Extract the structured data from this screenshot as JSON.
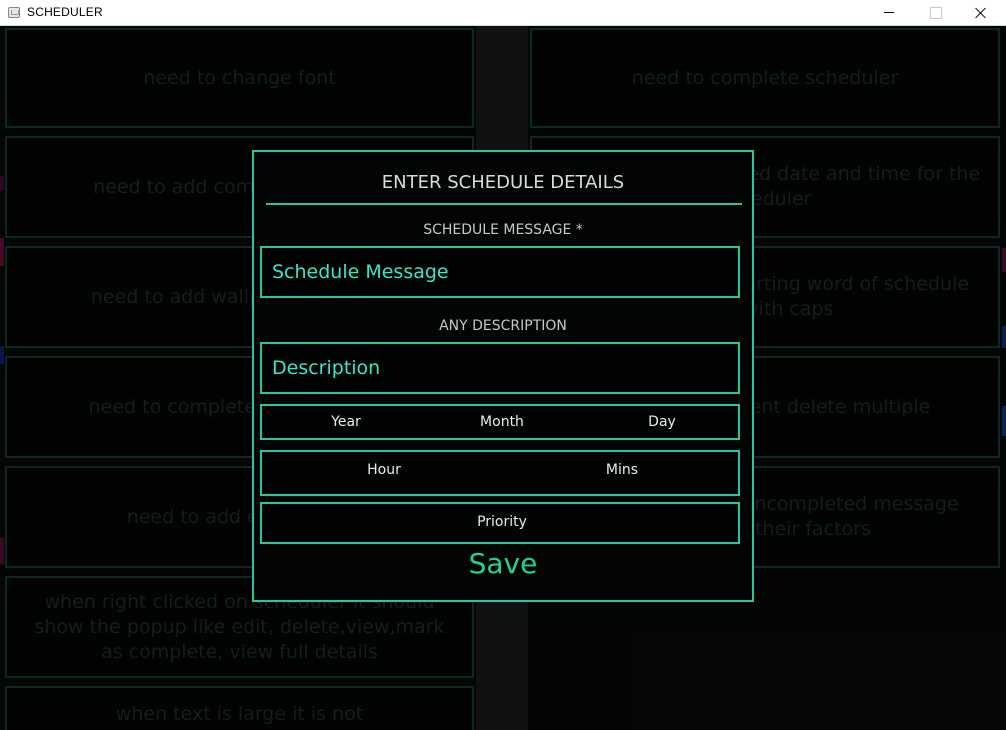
{
  "window": {
    "title": "SCHEDULER"
  },
  "cards": [
    "need to change font",
    "need to complete scheduler",
    "need to add complete multiple",
    "need to add completed date and time for the scheduler",
    "need to add wallpaper changer",
    "need to start the starting word of schedule msg with caps",
    "need to complete full scheduler",
    "need to implement delete multiple",
    "need to add edit button",
    "need to show the uncompleted message sorted by their factors",
    "when right clicked on scheduler it should show the popup like edit, delete,view,mark as complete, view full details",
    "when text is large it is not"
  ],
  "dialog": {
    "title": "ENTER SCHEDULE DETAILS",
    "message_label": "SCHEDULE MESSAGE *",
    "message_placeholder": "Schedule Message",
    "message_value": "",
    "description_label": "ANY DESCRIPTION",
    "description_placeholder": "Description",
    "description_value": "",
    "year": "Year",
    "month": "Month",
    "day": "Day",
    "hour": "Hour",
    "mins": "Mins",
    "priority": "Priority",
    "save": "Save"
  },
  "colors": {
    "accent": "#2bc3a2",
    "save": "#23d38d",
    "input_text": "#3fe4c0"
  }
}
